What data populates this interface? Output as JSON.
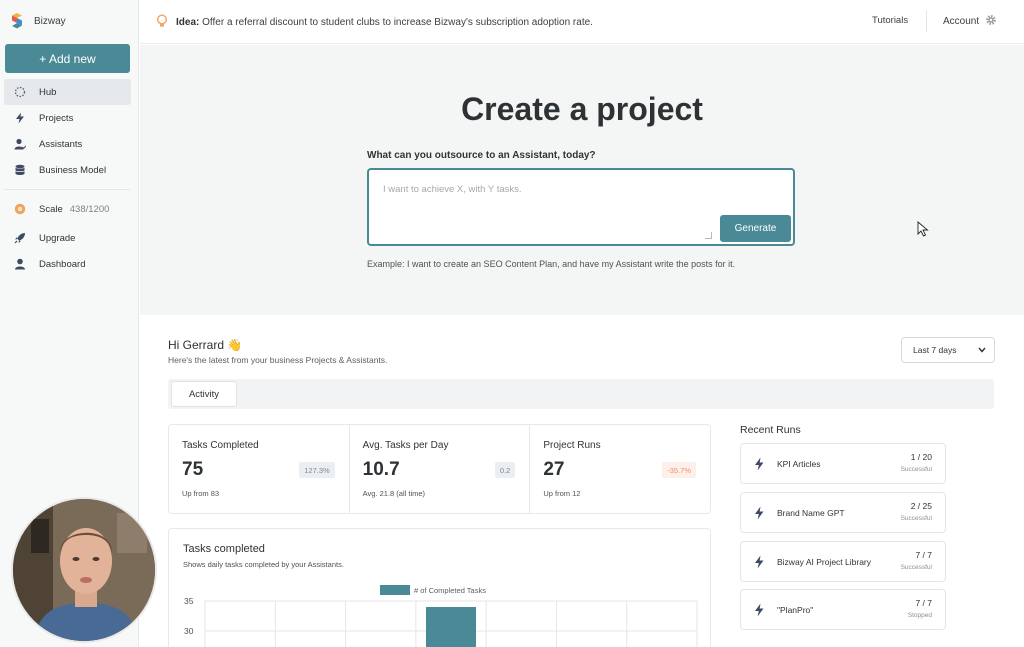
{
  "app": {
    "name": "Bizway"
  },
  "sidebar": {
    "add_new_label": "+ Add new",
    "nav": [
      {
        "label": "Hub",
        "icon": "hub-icon",
        "active": true
      },
      {
        "label": "Projects",
        "icon": "bolt-icon",
        "active": false
      },
      {
        "label": "Assistants",
        "icon": "assistant-icon",
        "active": false
      },
      {
        "label": "Business Model",
        "icon": "database-icon",
        "active": false
      }
    ],
    "scale": {
      "label": "Scale",
      "count": "438/1200"
    },
    "upgrade_label": "Upgrade",
    "dashboard_label": "Dashboard"
  },
  "topbar": {
    "idea_label": "Idea:",
    "idea_text": "Offer a referral discount to student clubs to increase Bizway's subscription adoption rate.",
    "tutorials_label": "Tutorials",
    "account_label": "Account"
  },
  "hero": {
    "title": "Create a project",
    "prompt_label": "What can you outsource to an Assistant, today?",
    "input_placeholder": "I want to achieve X, with Y tasks.",
    "generate_label": "Generate",
    "example": "Example: I want to create an SEO Content Plan, and have my Assistant write the posts for it."
  },
  "dashboard": {
    "greeting": "Hi Gerrard 👋",
    "greeting_sub": "Here's the latest from your business Projects & Assistants.",
    "period": "Last 7 days",
    "tabs": [
      "Activity"
    ],
    "stats": [
      {
        "label": "Tasks Completed",
        "value": "75",
        "badge": "127.3%",
        "badge_type": "positive",
        "sub": "Up from 83"
      },
      {
        "label": "Avg. Tasks per Day",
        "value": "10.7",
        "badge": "0.2",
        "badge_type": "positive",
        "sub": "Avg. 21.8 (all time)"
      },
      {
        "label": "Project Runs",
        "value": "27",
        "badge": "-35.7%",
        "badge_type": "negative",
        "sub": "Up from 12"
      }
    ],
    "chart": {
      "title": "Tasks completed",
      "subtitle": "Shows daily tasks completed by your Assistants."
    }
  },
  "chart_data": {
    "type": "bar",
    "title": "Tasks completed",
    "series": [
      {
        "name": "# of Completed Tasks",
        "values": [
          0,
          0,
          0,
          34,
          0,
          0,
          0
        ]
      }
    ],
    "ylim": [
      25,
      35
    ],
    "yticks": [
      35,
      30
    ],
    "grid": true,
    "legend": "top-center",
    "color": "#4a8a96"
  },
  "recent_runs": {
    "title": "Recent Runs",
    "items": [
      {
        "name": "KPI Articles",
        "count": "1 / 20",
        "status": "Successful"
      },
      {
        "name": "Brand Name GPT",
        "count": "2 / 25",
        "status": "Successful"
      },
      {
        "name": "Bizway AI Project Library",
        "count": "7 / 7",
        "status": "Successful"
      },
      {
        "name": "\"PlanPro\"",
        "count": "7 / 7",
        "status": "Stopped"
      }
    ]
  },
  "colors": {
    "accent": "#4a8a96",
    "negative": "#e8936b",
    "sidebar_bg": "#f7f8f8"
  }
}
